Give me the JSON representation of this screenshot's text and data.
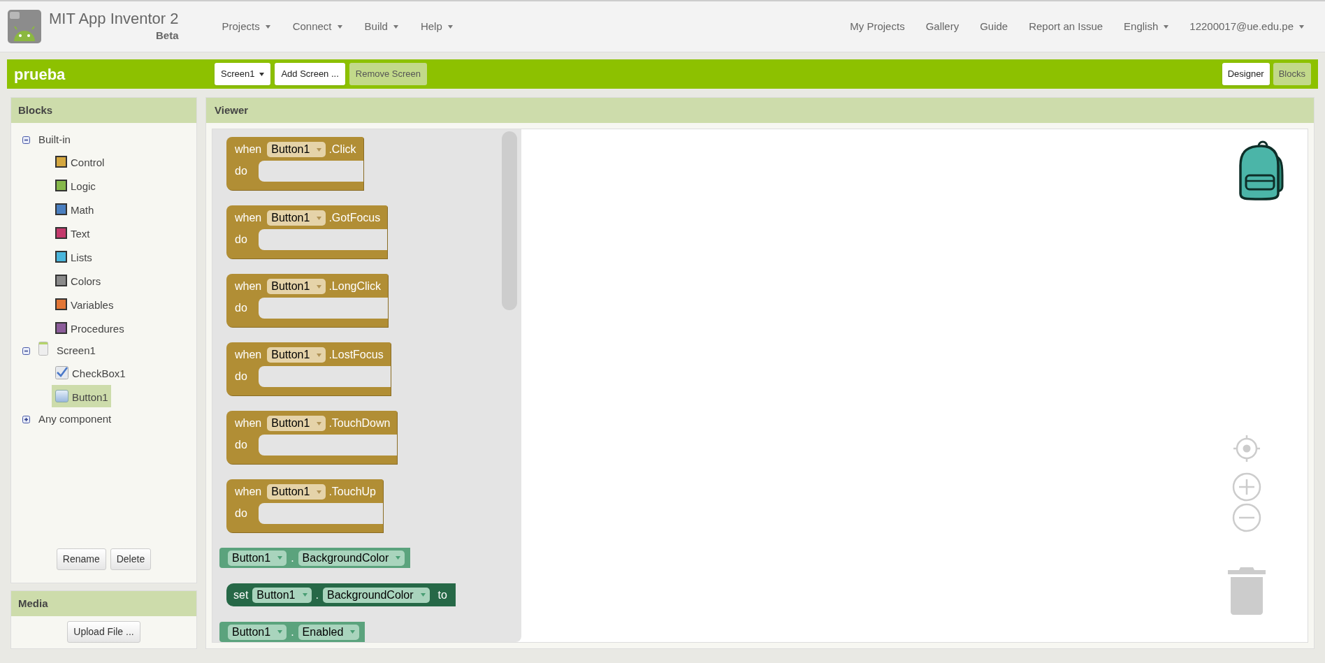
{
  "header": {
    "title": "MIT App Inventor 2",
    "subtitle": "Beta",
    "menus": [
      {
        "label": "Projects"
      },
      {
        "label": "Connect"
      },
      {
        "label": "Build"
      },
      {
        "label": "Help"
      }
    ],
    "links": [
      {
        "label": "My Projects"
      },
      {
        "label": "Gallery"
      },
      {
        "label": "Guide"
      },
      {
        "label": "Report an Issue"
      }
    ],
    "language": "English",
    "account": "12200017@ue.edu.pe"
  },
  "project_bar": {
    "name": "prueba",
    "screen_select": "Screen1",
    "buttons": [
      {
        "label": "Add Screen ...",
        "disabled": false
      },
      {
        "label": "Remove Screen",
        "disabled": true
      }
    ],
    "views": [
      {
        "label": "Designer",
        "selected": false
      },
      {
        "label": "Blocks",
        "selected": true
      }
    ]
  },
  "blocks_panel": {
    "title": "Blocks",
    "tree": [
      {
        "label": "Built-in",
        "kind": "group",
        "expanded": true,
        "children": [
          {
            "label": "Control",
            "kind": "category",
            "color": "#d4a73f",
            "selected": false
          },
          {
            "label": "Logic",
            "kind": "category",
            "color": "#86b84a",
            "selected": false
          },
          {
            "label": "Math",
            "kind": "category",
            "color": "#4a7fc0",
            "selected": false
          },
          {
            "label": "Text",
            "kind": "category",
            "color": "#c43a6c",
            "selected": false
          },
          {
            "label": "Lists",
            "kind": "category",
            "color": "#4ab6dc",
            "selected": false
          },
          {
            "label": "Colors",
            "kind": "category",
            "color": "#8a8a8a",
            "selected": false
          },
          {
            "label": "Variables",
            "kind": "category",
            "color": "#e27636",
            "selected": false
          },
          {
            "label": "Procedures",
            "kind": "category",
            "color": "#8c5d9a",
            "selected": false
          }
        ]
      },
      {
        "label": "Screen1",
        "kind": "screen",
        "expanded": true,
        "children": [
          {
            "label": "CheckBox1",
            "kind": "checkbox",
            "selected": false
          },
          {
            "label": "Button1",
            "kind": "button",
            "selected": true
          }
        ]
      },
      {
        "label": "Any component",
        "kind": "group",
        "expanded": false
      }
    ],
    "buttons": [
      "Rename",
      "Delete"
    ]
  },
  "media_panel": {
    "title": "Media",
    "button": "Upload File ..."
  },
  "viewer": {
    "title": "Viewer",
    "blocks": [
      {
        "kind": "event",
        "keyword": "when",
        "component": "Button1",
        "event": ".Click",
        "body": "do"
      },
      {
        "kind": "event",
        "keyword": "when",
        "component": "Button1",
        "event": ".GotFocus",
        "body": "do"
      },
      {
        "kind": "event",
        "keyword": "when",
        "component": "Button1",
        "event": ".LongClick",
        "body": "do"
      },
      {
        "kind": "event",
        "keyword": "when",
        "component": "Button1",
        "event": ".LostFocus",
        "body": "do"
      },
      {
        "kind": "event",
        "keyword": "when",
        "component": "Button1",
        "event": ".TouchDown",
        "body": "do"
      },
      {
        "kind": "event",
        "keyword": "when",
        "component": "Button1",
        "event": ".TouchUp",
        "body": "do"
      },
      {
        "kind": "getter",
        "component": "Button1",
        "separator": ".",
        "property": "BackgroundColor"
      },
      {
        "kind": "setter",
        "keyword": "set",
        "component": "Button1",
        "separator": ".",
        "property": "BackgroundColor",
        "to": "to"
      },
      {
        "kind": "getter",
        "component": "Button1",
        "separator": ".",
        "property": "Enabled"
      }
    ]
  }
}
